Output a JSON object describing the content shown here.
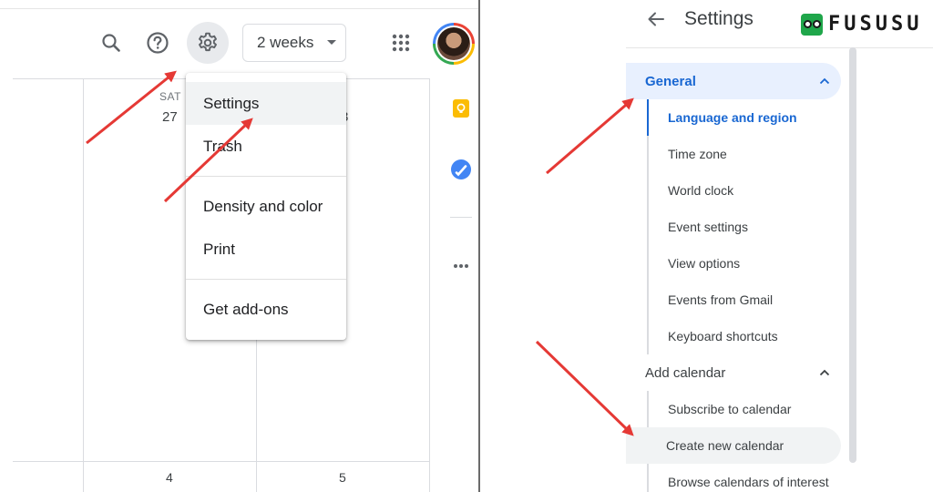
{
  "left_panel": {
    "view_selector": "2 weeks",
    "days": [
      {
        "header": "SAT",
        "date": "27"
      },
      {
        "header": "N",
        "date": "8"
      }
    ],
    "bottom_dates": [
      "4",
      "5"
    ],
    "menu": {
      "items": [
        "Settings",
        "Trash",
        "Density and color",
        "Print",
        "Get add-ons"
      ]
    }
  },
  "right_panel": {
    "title": "Settings",
    "logo_text": "FUSUSU",
    "sections": [
      {
        "label": "General",
        "items": [
          "Language and region",
          "Time zone",
          "World clock",
          "Event settings",
          "View options",
          "Events from Gmail",
          "Keyboard shortcuts"
        ]
      },
      {
        "label": "Add calendar",
        "items": [
          "Subscribe to calendar",
          "Create new calendar",
          "Browse calendars of interest"
        ]
      }
    ]
  },
  "colors": {
    "annotation_arrow": "#e53935",
    "active_blue": "#1967d2",
    "active_bg": "#e8f0fe",
    "gear_bg": "#e8eaed",
    "logo_green": "#1fa64a"
  }
}
